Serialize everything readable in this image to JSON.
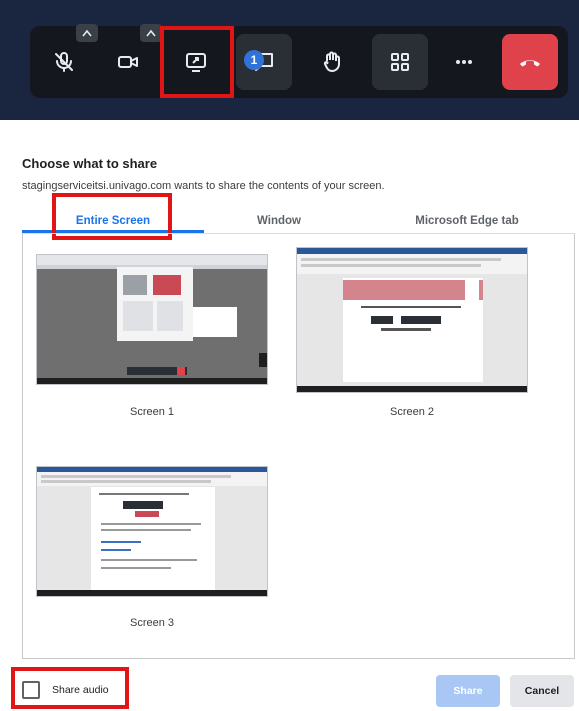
{
  "toolbar": {
    "buttons": [
      {
        "name": "mute-mic",
        "icon": "mic-off-icon"
      },
      {
        "name": "camera",
        "icon": "camera-icon"
      },
      {
        "name": "share-screen",
        "icon": "screen-share-icon"
      },
      {
        "name": "chat",
        "icon": "chat-icon"
      },
      {
        "name": "raise-hand",
        "icon": "hand-icon"
      },
      {
        "name": "tile-view",
        "icon": "grid-icon"
      },
      {
        "name": "more",
        "icon": "more-icon"
      },
      {
        "name": "hang-up",
        "icon": "phone-hangup-icon"
      }
    ],
    "chat_badge": "1",
    "colors": {
      "background": "#1a2540",
      "bar": "#14181e",
      "hangup": "#e0424c",
      "badge": "#2f73d9",
      "highlight": "#e01515"
    }
  },
  "dialog": {
    "title": "Choose what to share",
    "description": "stagingserviceitsi.univago.com wants to share the contents of your screen.",
    "tabs": [
      {
        "label": "Entire Screen",
        "active": true
      },
      {
        "label": "Window",
        "active": false
      },
      {
        "label": "Microsoft Edge tab",
        "active": false
      }
    ],
    "screens": [
      {
        "label": "Screen 1"
      },
      {
        "label": "Screen 2"
      },
      {
        "label": "Screen 3"
      }
    ],
    "share_audio_label": "Share audio",
    "share_audio_checked": false,
    "share_button": "Share",
    "cancel_button": "Cancel",
    "colors": {
      "accent": "#1a73e8",
      "share_disabled": "#a8c7f5"
    }
  }
}
